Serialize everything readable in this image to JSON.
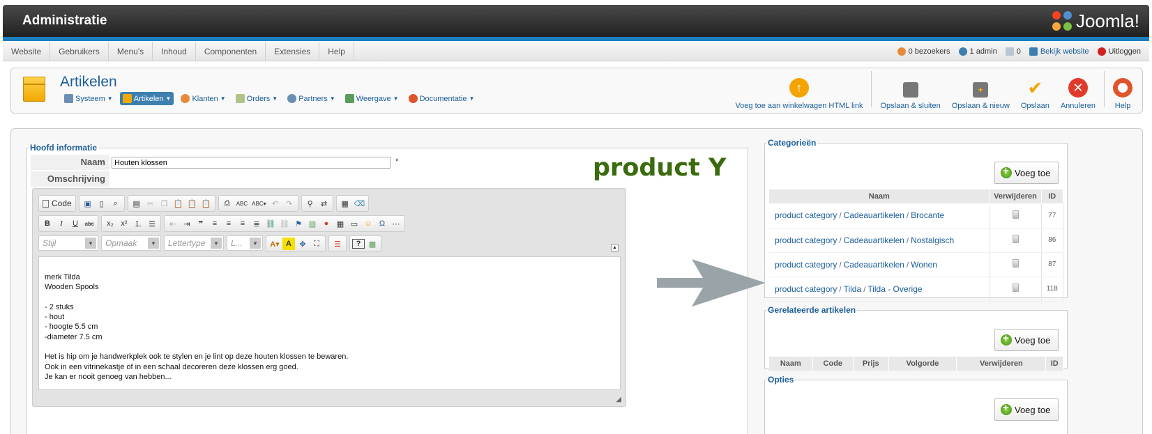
{
  "header": {
    "title": "Administratie",
    "logo_text": "Joomla!"
  },
  "menu": {
    "items": [
      "Website",
      "Gebruikers",
      "Menu's",
      "Inhoud",
      "Componenten",
      "Extensies",
      "Help"
    ]
  },
  "status": {
    "visitors": "0 bezoekers",
    "admins": "1 admin",
    "messages": "0",
    "view_site": "Bekijk website",
    "logout": "Uitloggen"
  },
  "toolbar": {
    "page_title": "Artikelen",
    "submenu": [
      "Systeem",
      "Artikelen",
      "Klanten",
      "Orders",
      "Partners",
      "Weergave",
      "Documentatie"
    ],
    "active_submenu": "Artikelen",
    "buttons": {
      "add_cart_link": "Voeg toe aan winkelwagen HTML link",
      "save_close": "Opslaan & sluiten",
      "save_new": "Opslaan & nieuw",
      "save": "Opslaan",
      "cancel": "Annuleren",
      "help": "Help"
    }
  },
  "main_info": {
    "legend": "Hoofd informatie",
    "name_label": "Naam",
    "name_value": "Houten klossen",
    "required_mark": "*",
    "description_label": "Omschrijving",
    "annotation": "product Y"
  },
  "editor": {
    "code_label": "Code",
    "style_placeholder": "Stijl",
    "format_placeholder": "Opmaak",
    "font_placeholder": "Lettertype",
    "size_placeholder": "L...",
    "content": "merk Tilda\nWooden Spools\n\n- 2 stuks\n- hout\n- hoogte 5.5 cm\n-diameter 7.5 cm\n\nHet is hip om je handwerkplek ook te stylen en je lint op deze houten klossen te bewaren.\nOok in een vitrinekastje of in een schaal decoreren deze klossen erg goed.\nJe kan er nooit genoeg van hebben..."
  },
  "categories": {
    "legend": "Categorieën",
    "add_label": "Voeg toe",
    "columns": [
      "Naam",
      "Verwijderen",
      "ID"
    ],
    "rows": [
      {
        "path": [
          "product category",
          "Cadeauartikelen",
          "Brocante"
        ],
        "id": "77"
      },
      {
        "path": [
          "product category",
          "Cadeauartikelen",
          "Nostalgisch"
        ],
        "id": "86"
      },
      {
        "path": [
          "product category",
          "Cadeauartikelen",
          "Wonen"
        ],
        "id": "87"
      },
      {
        "path": [
          "product category",
          "Tilda",
          "Tilda - Overige"
        ],
        "id": "118"
      }
    ]
  },
  "related": {
    "legend": "Gerelateerde artikelen",
    "add_label": "Voeg toe",
    "columns": [
      "Naam",
      "Code",
      "Prijs",
      "Volgorde",
      "Verwijderen",
      "ID"
    ]
  },
  "options": {
    "legend": "Opties",
    "add_label": "Voeg toe"
  },
  "colors": {
    "accent": "#1b5e9a",
    "header_bar": "#1b7fc0",
    "annotation": "#3a6b0d",
    "arrow": "#9aa4a8"
  }
}
